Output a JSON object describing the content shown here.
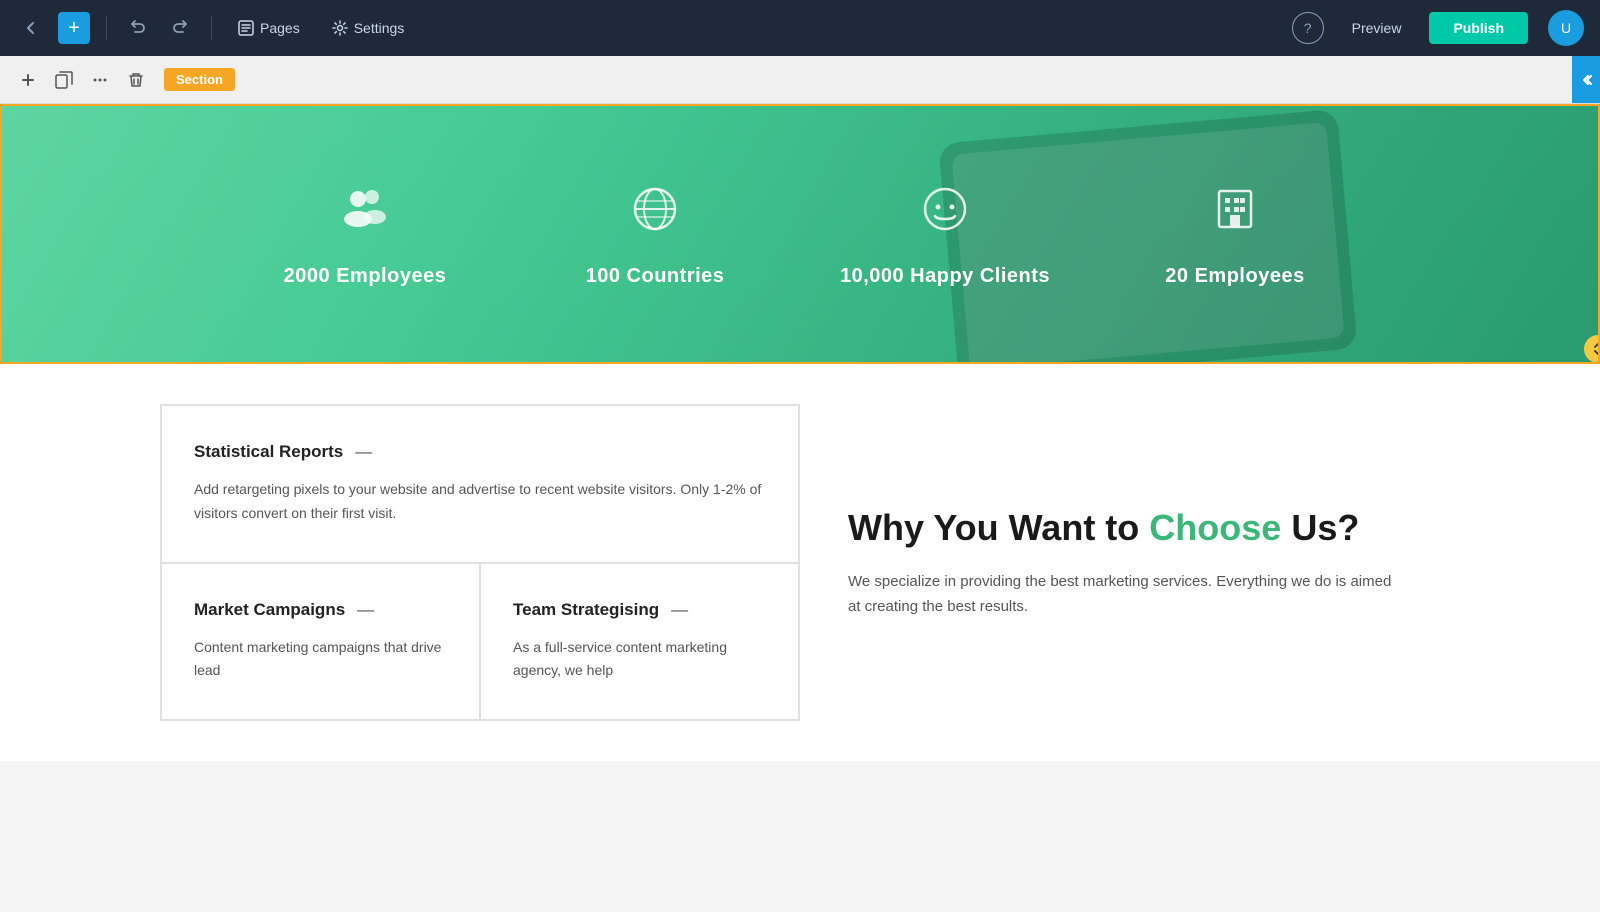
{
  "navbar": {
    "back_icon": "←",
    "add_icon": "+",
    "undo_icon": "↩",
    "redo_icon": "↪",
    "pages_label": "Pages",
    "pages_icon": "▭",
    "settings_label": "Settings",
    "settings_icon": "⚙",
    "help_icon": "?",
    "preview_label": "Preview",
    "publish_label": "Publish",
    "avatar_text": "U"
  },
  "toolbar": {
    "add_icon": "+",
    "copy_icon": "⧉",
    "settings_icon": "≡",
    "delete_icon": "🗑",
    "section_label": "Section",
    "collapse_icon": "«",
    "expand_icon": "⇅"
  },
  "stats": {
    "items": [
      {
        "id": "employees",
        "icon": "👥",
        "label": "2000 Employees"
      },
      {
        "id": "countries",
        "icon": "🌐",
        "label": "100 Countries"
      },
      {
        "id": "clients",
        "icon": "😊",
        "label": "10,000 Happy Clients"
      },
      {
        "id": "offices",
        "icon": "🏢",
        "label": "20 Employees"
      }
    ]
  },
  "cards": [
    {
      "id": "statistical-reports",
      "title": "Statistical Reports",
      "dash": "—",
      "text": "Add retargeting pixels to your website and advertise to recent website visitors. Only 1-2% of visitors convert on their first visit."
    },
    {
      "id": "market-campaigns",
      "title": "Market Campaigns",
      "dash": "—",
      "text": "Content marketing campaigns that drive lead"
    },
    {
      "id": "team-strategising",
      "title": "Team Strategising",
      "dash": "—",
      "text": "As a full-service content marketing agency, we help"
    }
  ],
  "why_section": {
    "title_part1": "Why You Want to ",
    "title_highlight": "Choose",
    "title_part2": " Us?",
    "text": "We specialize in providing the best marketing services. Everything we do is aimed at creating the best results."
  }
}
